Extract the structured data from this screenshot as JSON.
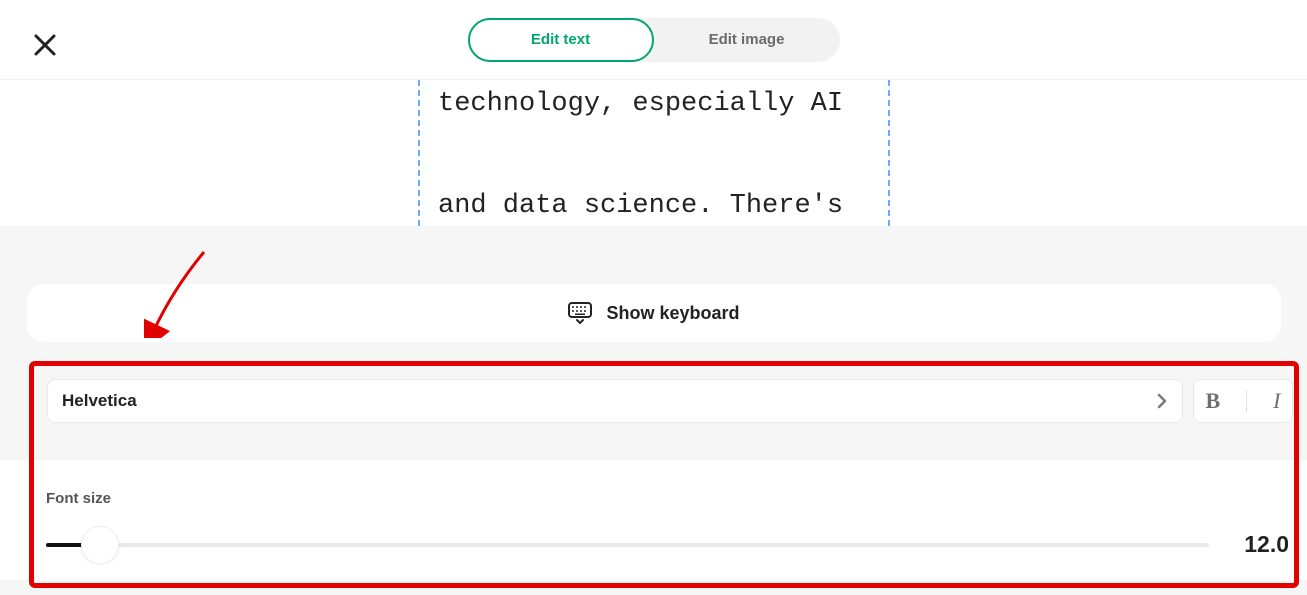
{
  "header": {
    "tab_edit_text": "Edit text",
    "tab_edit_image": "Edit image"
  },
  "editor": {
    "line1": "technology, especially AI",
    "line2": "and data science. There's"
  },
  "keyboard": {
    "show_label": "Show keyboard"
  },
  "font": {
    "selected": "Helvetica"
  },
  "size": {
    "label": "Font size",
    "value": "12.0"
  }
}
